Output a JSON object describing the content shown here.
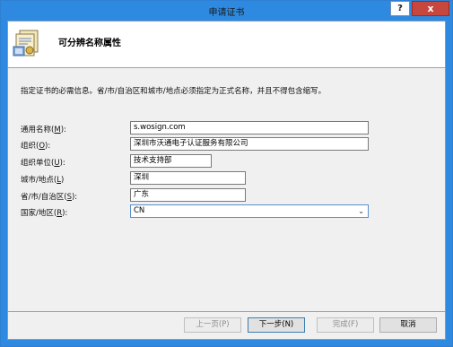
{
  "window": {
    "title": "申请证书",
    "help_label": "?",
    "close_label": "x"
  },
  "header": {
    "title": "可分辨名称属性",
    "icon": "certificate-icon"
  },
  "instructions": "指定证书的必需信息。省/市/自治区和城市/地点必须指定为正式名称，并且不得包含缩写。",
  "fields": [
    {
      "label": "通用名称",
      "key": "M",
      "value": "s.wosign.com"
    },
    {
      "label": "组织",
      "key": "O",
      "value": "深圳市沃通电子认证服务有限公司"
    },
    {
      "label": "组织单位",
      "key": "U",
      "value": "技术支持部"
    },
    {
      "label": "城市/地点",
      "key": "L",
      "value": "深圳"
    },
    {
      "label": "省/市/自治区",
      "key": "S",
      "value": "广东"
    },
    {
      "label": "国家/地区",
      "key": "R",
      "value": "CN"
    }
  ],
  "buttons": {
    "prev": "上一页(P)",
    "next": "下一步(N)",
    "finish": "完成(F)",
    "cancel": "取消"
  },
  "colors": {
    "titlebar": "#2e8ae0",
    "close": "#c7463d"
  }
}
